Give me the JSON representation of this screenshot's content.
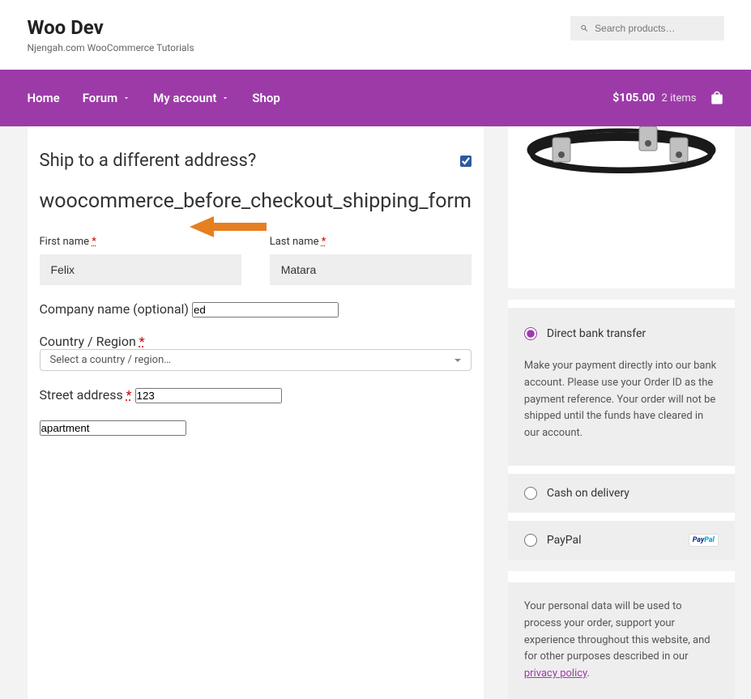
{
  "header": {
    "site_title": "Woo Dev",
    "tagline": "Njengah.com WooCommerce Tutorials",
    "search_placeholder": "Search products…"
  },
  "nav": {
    "items": [
      "Home",
      "Forum",
      "My account",
      "Shop"
    ],
    "cart_total": "$105.00",
    "cart_items": "2 items"
  },
  "shipping": {
    "heading": "Ship to a different address?",
    "hook": "woocommerce_before_checkout_shipping_form",
    "first_name_label": "First name",
    "first_name_value": "Felix",
    "last_name_label": "Last name",
    "last_name_value": "Matara",
    "company_label": "Company name (optional)",
    "company_value": "ed",
    "country_label": "Country / Region",
    "country_placeholder": "Select a country / region…",
    "street_label": "Street address",
    "street_value": "123",
    "apartment_value": "apartment",
    "required_mark": "*"
  },
  "payment": {
    "option1": "Direct bank transfer",
    "option1_desc": "Make your payment directly into our bank account. Please use your Order ID as the payment reference. Your order will not be shipped until the funds have cleared in our account.",
    "option2": "Cash on delivery",
    "option3": "PayPal"
  },
  "privacy": {
    "text": "Your personal data will be used to process your order, support your experience throughout this website, and for other purposes described in our ",
    "link": "privacy policy",
    "suffix": "."
  }
}
